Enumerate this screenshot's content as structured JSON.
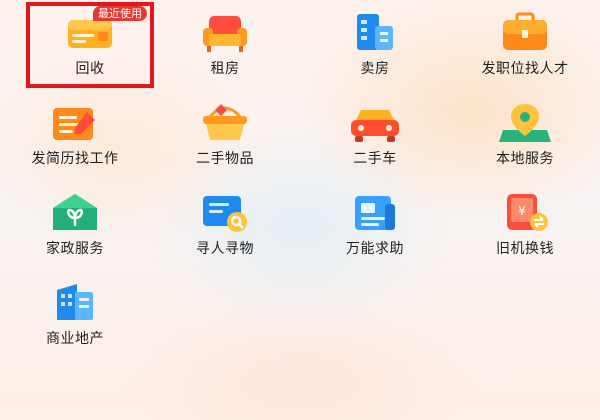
{
  "recent_badge": "最近使用",
  "items": [
    {
      "label": "回收",
      "icon": "recycle-card-icon"
    },
    {
      "label": "租房",
      "icon": "sofa-icon"
    },
    {
      "label": "卖房",
      "icon": "building-icon"
    },
    {
      "label": "发职位找人才",
      "icon": "briefcase-icon"
    },
    {
      "label": "发简历找工作",
      "icon": "resume-pencil-icon"
    },
    {
      "label": "二手物品",
      "icon": "basket-icon"
    },
    {
      "label": "二手车",
      "icon": "car-icon"
    },
    {
      "label": "本地服务",
      "icon": "map-pin-icon"
    },
    {
      "label": "家政服务",
      "icon": "house-leaf-icon"
    },
    {
      "label": "寻人寻物",
      "icon": "search-card-icon"
    },
    {
      "label": "万能求助",
      "icon": "newspaper-icon"
    },
    {
      "label": "旧机换钱",
      "icon": "phone-exchange-icon"
    },
    {
      "label": "商业地产",
      "icon": "office-building-icon"
    }
  ]
}
